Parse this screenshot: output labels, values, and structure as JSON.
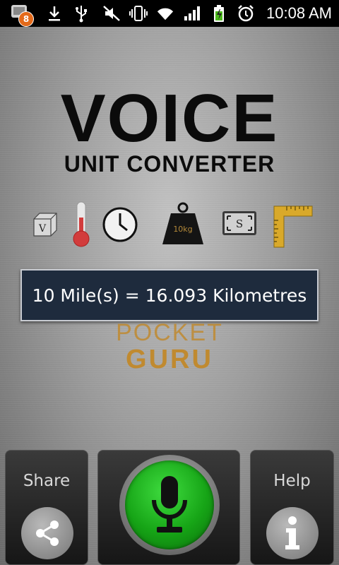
{
  "status_bar": {
    "notification_count": "8",
    "time": "10:08 AM",
    "icons": [
      "notification-badge-icon",
      "download-icon",
      "usb-icon",
      "mute-icon",
      "vibrate-icon",
      "wifi-icon",
      "signal-icon",
      "battery-charging-icon",
      "alarm-icon"
    ]
  },
  "logo": {
    "title": "VOICE",
    "subtitle": "UNIT CONVERTER"
  },
  "unit_icons": {
    "volume_label": "V",
    "weight_label": "10kg",
    "speed_label": "S",
    "names": [
      "volume-cube-icon",
      "thermometer-icon",
      "clock-icon",
      "weight-icon",
      "speed-icon",
      "ruler-icon"
    ]
  },
  "result": {
    "text": "10 Mile(s) = 16.093 Kilometres"
  },
  "brand": {
    "top": "POCKET",
    "bottom": "GURU"
  },
  "buttons": {
    "share_label": "Share",
    "help_label": "Help"
  },
  "colors": {
    "result_bg": "#1e2b3d",
    "mic_green": "#16a416",
    "brand_orange": "#c08a30"
  }
}
